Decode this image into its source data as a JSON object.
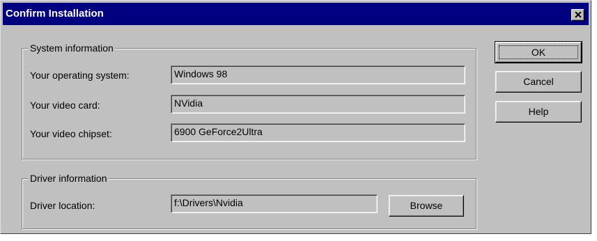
{
  "window": {
    "title": "Confirm Installation",
    "close_glyph": "×"
  },
  "system_info": {
    "legend": "System information",
    "os_label": "Your operating system:",
    "os_value": "Windows 98",
    "video_card_label": "Your video card:",
    "video_card_value": "NVidia",
    "chipset_label": "Your video chipset:",
    "chipset_value": "6900 GeForce2Ultra"
  },
  "driver_info": {
    "legend": "Driver information",
    "location_label": "Driver location:",
    "location_value": "f:\\Drivers\\Nvidia",
    "browse_label": "Browse"
  },
  "buttons": {
    "ok_label": "OK",
    "cancel_label": "Cancel",
    "help_label": "Help"
  },
  "colors": {
    "titlebar": "#000080",
    "face": "#c0c0c0",
    "title_text": "#ffffff"
  },
  "icons": {
    "close": "close-icon"
  }
}
